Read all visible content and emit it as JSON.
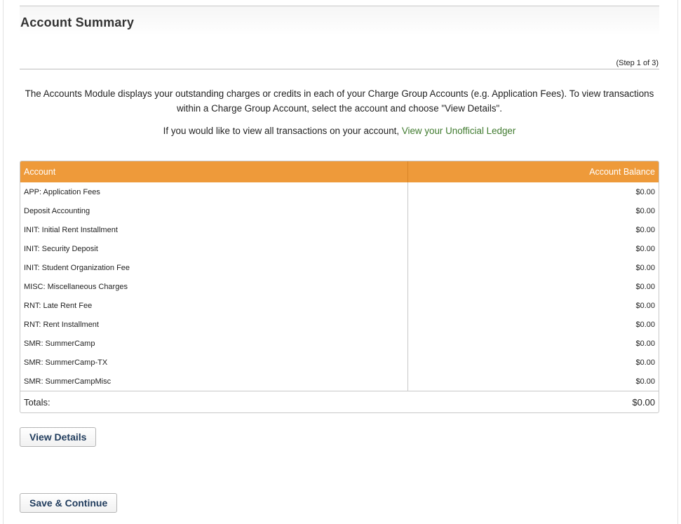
{
  "header": {
    "title": "Account Summary",
    "step": "(Step 1 of 3)"
  },
  "intro": {
    "paragraph": "The Accounts Module displays your outstanding charges or credits in each of your Charge Group Accounts (e.g. Application Fees). To view transactions within a Charge Group Account, select the account and choose \"View Details\".",
    "ledger_prefix": "If you would like to view all transactions on your account, ",
    "ledger_link": "View your Unofficial Ledger"
  },
  "table": {
    "columns": [
      "Account",
      "Account Balance"
    ],
    "rows": [
      {
        "account": "APP: Application Fees",
        "balance": "$0.00"
      },
      {
        "account": "Deposit Accounting",
        "balance": "$0.00"
      },
      {
        "account": "INIT: Initial Rent Installment",
        "balance": "$0.00"
      },
      {
        "account": "INIT: Security Deposit",
        "balance": "$0.00"
      },
      {
        "account": "INIT: Student Organization Fee",
        "balance": "$0.00"
      },
      {
        "account": "MISC: Miscellaneous Charges",
        "balance": "$0.00"
      },
      {
        "account": "RNT: Late Rent Fee",
        "balance": "$0.00"
      },
      {
        "account": "RNT: Rent Installment",
        "balance": "$0.00"
      },
      {
        "account": "SMR: SummerCamp",
        "balance": "$0.00"
      },
      {
        "account": "SMR: SummerCamp-TX",
        "balance": "$0.00"
      },
      {
        "account": "SMR: SummerCampMisc",
        "balance": "$0.00"
      }
    ],
    "totals_label": "Totals:",
    "totals_value": "$0.00"
  },
  "actions": {
    "view_details": "View Details",
    "save_continue": "Save & Continue"
  },
  "colors": {
    "header_accent": "#ee9a3a",
    "link": "#3f7a2e",
    "button_text": "#1f3b5c"
  }
}
